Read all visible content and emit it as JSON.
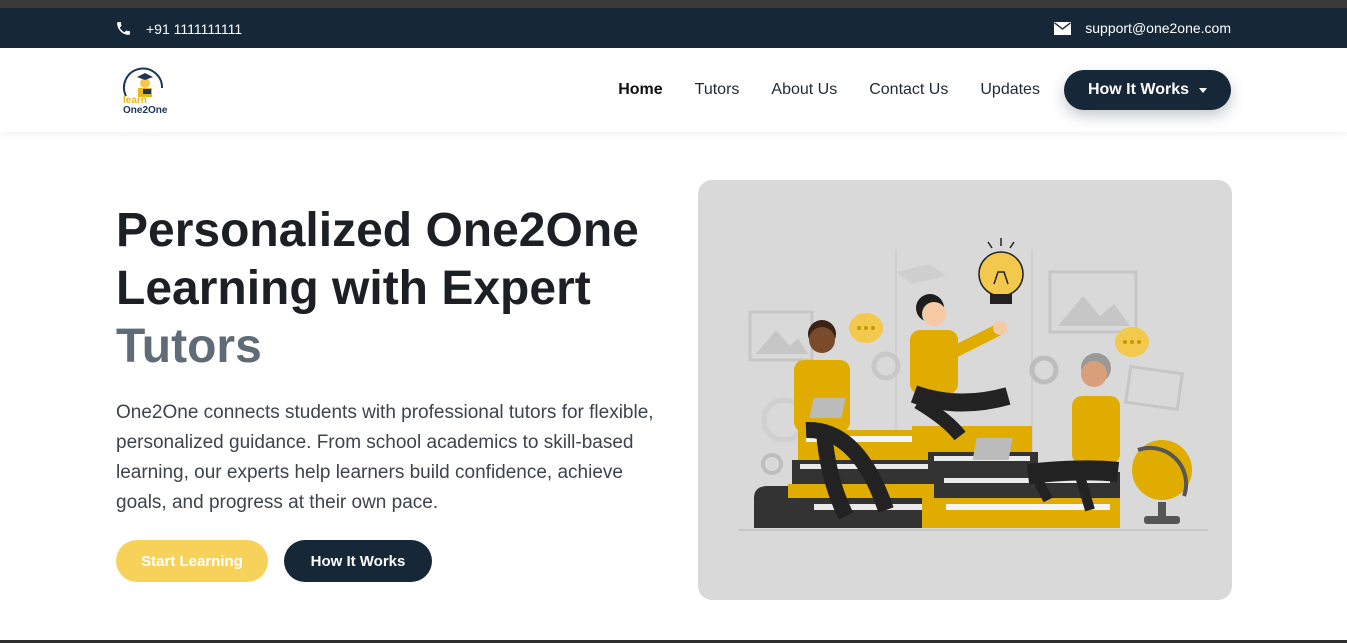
{
  "topbar": {
    "phone": "+91 1111111111",
    "email": "support@one2one.com",
    "phone_icon": "phone-icon",
    "mail_icon": "mail-icon"
  },
  "logo": {
    "line1": "learn",
    "line2": "One2One"
  },
  "nav": {
    "items": [
      "Home",
      "Tutors",
      "About Us",
      "Contact Us",
      "Updates"
    ],
    "dropdown_label": "How It Works"
  },
  "hero": {
    "title_line1": "Personalized One2One",
    "title_line2": "Learning with Expert",
    "title_accent": "Tutors",
    "description": "One2One connects students with professional tutors for flexible, personalized guidance. From school academics to skill-based learning, our experts help learners build confidence, achieve goals, and progress at their own pace.",
    "primary_button": "Start Learning",
    "secondary_button": "How It Works"
  },
  "colors": {
    "dark_navy": "#162738",
    "accent_yellow": "#f7d25b",
    "illustration_yellow": "#e0ac00"
  }
}
